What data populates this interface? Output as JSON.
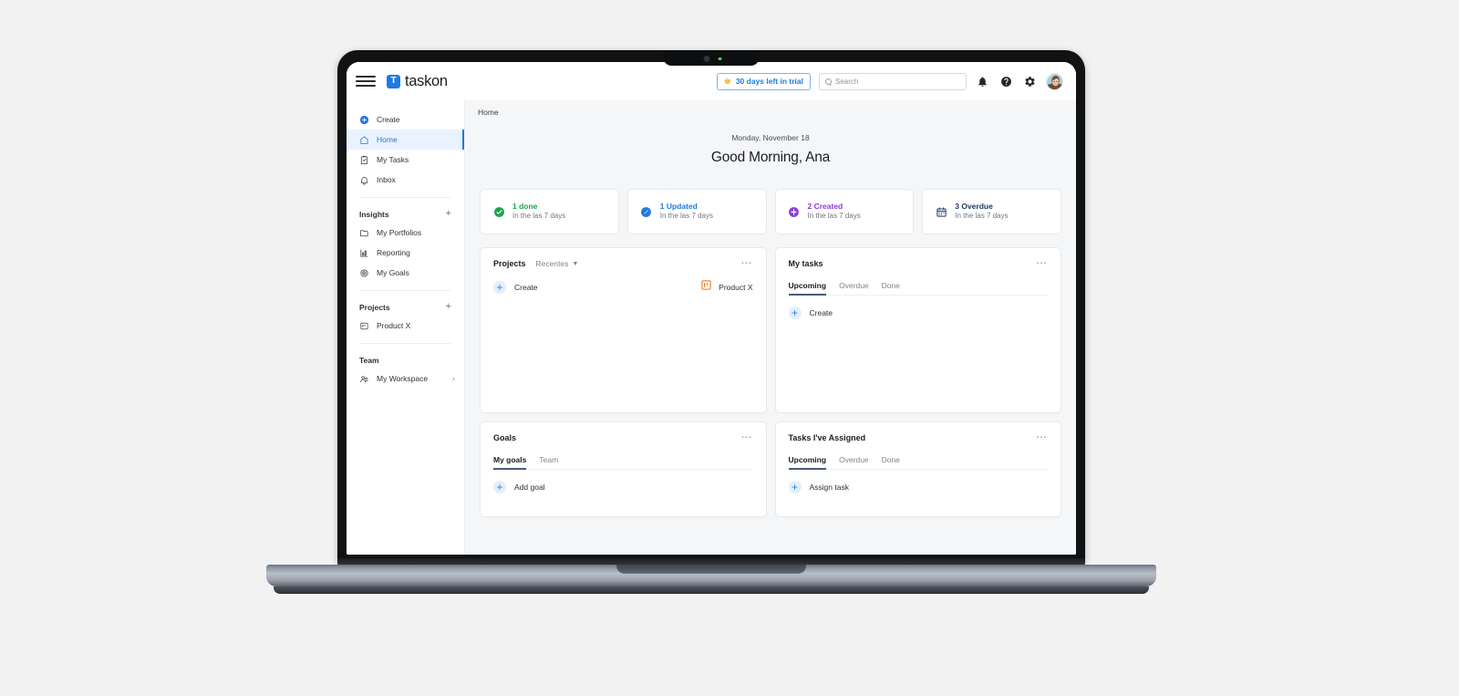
{
  "app": {
    "brand_mark": "T",
    "brand_name": "taskon"
  },
  "topbar": {
    "hamburger_icon": "hamburger-menu-icon",
    "trial": {
      "crown_icon": "crown-icon",
      "label": "30 days left in trial"
    },
    "search": {
      "icon": "search-icon",
      "placeholder": "Search",
      "value": ""
    },
    "notifications_icon": "bell-icon",
    "help_icon": "question-circle-icon",
    "settings_icon": "gear-icon",
    "avatar_icon": "user-avatar"
  },
  "sidebar": {
    "primary": [
      {
        "label": "Create",
        "icon": "plus-circle-icon",
        "active": false
      },
      {
        "label": "Home",
        "icon": "home-icon",
        "active": true
      },
      {
        "label": "My Tasks",
        "icon": "clipboard-check-icon",
        "active": false
      },
      {
        "label": "Inbox",
        "icon": "bell-icon",
        "active": false
      }
    ],
    "insights": {
      "title": "Insights",
      "add_icon": "plus-icon",
      "items": [
        {
          "label": "My Portfolios",
          "icon": "folder-icon"
        },
        {
          "label": "Reporting",
          "icon": "bar-chart-icon"
        },
        {
          "label": "My Goals",
          "icon": "target-icon"
        }
      ]
    },
    "projects": {
      "title": "Projects",
      "add_icon": "plus-icon",
      "items": [
        {
          "label": "Product X",
          "icon": "board-icon"
        }
      ]
    },
    "team": {
      "title": "Team",
      "items": [
        {
          "label": "My Workspace",
          "icon": "people-icon",
          "chevron": "chevron-right-icon"
        }
      ]
    }
  },
  "main": {
    "breadcrumb": "Home",
    "greeting": {
      "date": "Monday, November 18",
      "title": "Good Morning,  Ana"
    },
    "stats": [
      {
        "value": "1 done",
        "sub": "In the las 7 days",
        "color": "#1aa34a",
        "icon": "check-circle-icon"
      },
      {
        "value": "1 Updated",
        "sub": "In the las 7 days",
        "color": "#1f7ae0",
        "icon": "pencil-circle-icon"
      },
      {
        "value": "2 Created",
        "sub": "In the las 7 days",
        "color": "#8b3ddb",
        "icon": "plus-circle-icon"
      },
      {
        "value": "3 Overdue",
        "sub": "In the las 7 days",
        "color": "#1f3a68",
        "icon": "calendar-icon"
      }
    ],
    "widgets": {
      "projects": {
        "title": "Projects",
        "filter": "Recentes",
        "filter_chevron": "chevron-down-icon",
        "more_icon": "ellipsis-icon",
        "create_label": "Create",
        "create_icon": "plus-icon",
        "item": {
          "label": "Product X",
          "icon": "board-icon",
          "color": "#ef7712"
        }
      },
      "my_tasks": {
        "title": "My tasks",
        "more_icon": "ellipsis-icon",
        "tabs": [
          {
            "label": "Upcoming",
            "active": true
          },
          {
            "label": "Overdue",
            "active": false
          },
          {
            "label": "Done",
            "active": false
          }
        ],
        "create_label": "Create",
        "create_icon": "plus-icon"
      },
      "goals": {
        "title": "Goals",
        "more_icon": "ellipsis-icon",
        "tabs": [
          {
            "label": "My goals",
            "active": true
          },
          {
            "label": "Team",
            "active": false
          }
        ],
        "create_label": "Add goal",
        "create_icon": "plus-icon"
      },
      "assigned": {
        "title": "Tasks I've Assigned",
        "more_icon": "ellipsis-icon",
        "tabs": [
          {
            "label": "Upcoming",
            "active": true
          },
          {
            "label": "Overdue",
            "active": false
          },
          {
            "label": "Done",
            "active": false
          }
        ],
        "create_label": "Assign task",
        "create_icon": "plus-icon"
      }
    }
  },
  "colors": {
    "accent": "#1f7ae0",
    "page_bg": "#f5f6f7",
    "canvas_bg": "#f2f2f2"
  }
}
